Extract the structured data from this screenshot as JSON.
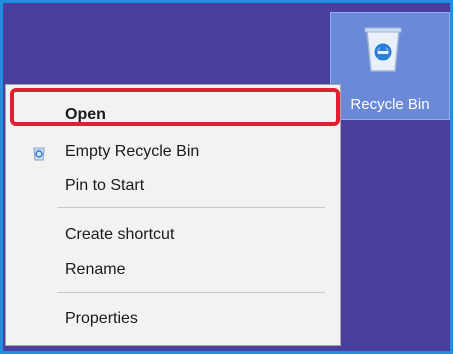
{
  "desktop": {
    "background": "#4a3f9f",
    "icon": {
      "label": "Recycle Bin",
      "icon": "recycle-bin-icon"
    }
  },
  "context_menu": {
    "items": [
      {
        "label": "Open",
        "bold": true,
        "highlighted": true
      },
      {
        "label": "Empty Recycle Bin",
        "icon": "recycle-bin-icon"
      },
      {
        "label": "Pin to Start"
      },
      {
        "label": "Create shortcut"
      },
      {
        "label": "Rename"
      },
      {
        "label": "Properties"
      }
    ]
  },
  "highlight_color": "#e02030"
}
